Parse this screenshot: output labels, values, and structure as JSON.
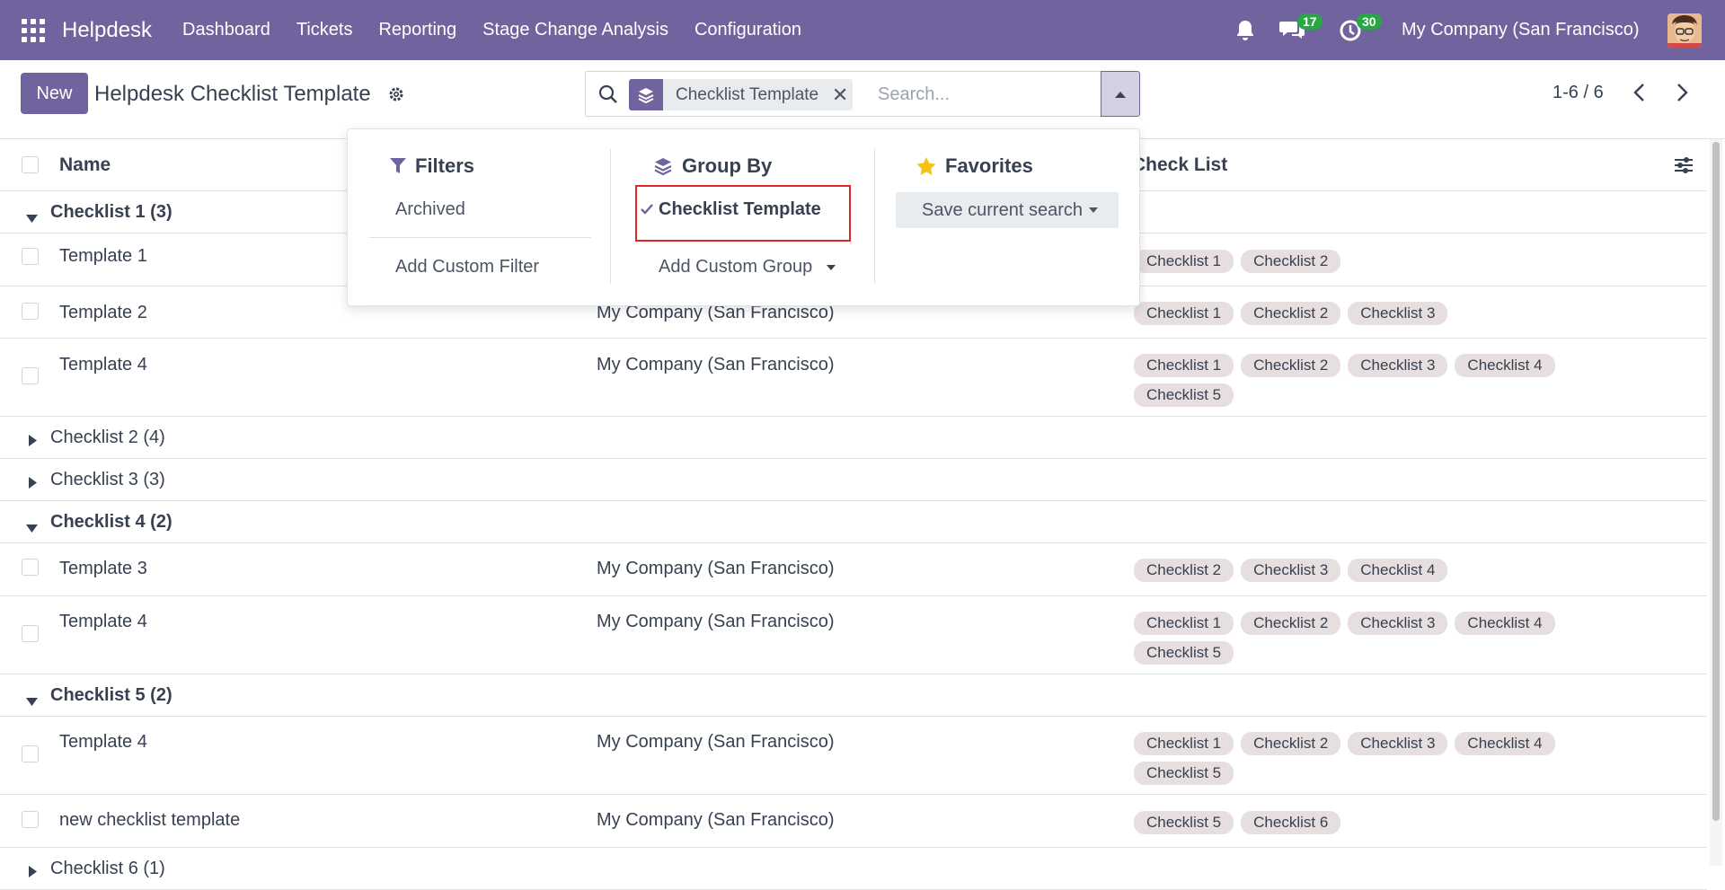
{
  "navbar": {
    "brand": "Helpdesk",
    "menu": [
      "Dashboard",
      "Tickets",
      "Reporting",
      "Stage Change Analysis",
      "Configuration"
    ],
    "chat_count": "17",
    "activity_count": "30",
    "company": "My Company (San Francisco)",
    "color": "#71639e"
  },
  "control": {
    "new_label": "New",
    "title": "Helpdesk Checklist Template",
    "facet_label": "Checklist Template",
    "search_placeholder": "Search...",
    "pager": "1-6 / 6"
  },
  "list": {
    "columns": [
      "Name",
      "Check List"
    ],
    "groups": [
      {
        "label": "Checklist 1 (3)",
        "open": true
      },
      {
        "label": "Checklist 2 (4)",
        "open": false
      },
      {
        "label": "Checklist 3 (3)",
        "open": false
      },
      {
        "label": "Checklist 4 (2)",
        "open": true
      },
      {
        "label": "Checklist 5 (2)",
        "open": true
      },
      {
        "label": "Checklist 6 (1)",
        "open": false
      }
    ],
    "rows": [
      {
        "name": "Template 1",
        "company": "",
        "tags": [
          "Checklist 1",
          "Checklist 2"
        ]
      },
      {
        "name": "Template 2",
        "company": "My Company (San Francisco)",
        "tags": [
          "Checklist 1",
          "Checklist 2",
          "Checklist 3"
        ]
      },
      {
        "name": "Template 4",
        "company": "My Company (San Francisco)",
        "tags": [
          "Checklist 1",
          "Checklist 2",
          "Checklist 3",
          "Checklist 4",
          "Checklist 5"
        ]
      },
      {
        "name": "Template 3",
        "company": "My Company (San Francisco)",
        "tags": [
          "Checklist 2",
          "Checklist 3",
          "Checklist 4"
        ]
      },
      {
        "name": "Template 4",
        "company": "My Company (San Francisco)",
        "tags": [
          "Checklist 1",
          "Checklist 2",
          "Checklist 3",
          "Checklist 4",
          "Checklist 5"
        ]
      },
      {
        "name": "Template 4",
        "company": "My Company (San Francisco)",
        "tags": [
          "Checklist 1",
          "Checklist 2",
          "Checklist 3",
          "Checklist 4",
          "Checklist 5"
        ]
      },
      {
        "name": "new checklist template",
        "company": "My Company (San Francisco)",
        "tags": [
          "Checklist 5",
          "Checklist 6"
        ]
      }
    ]
  },
  "dropdown": {
    "filters": {
      "title": "Filters",
      "items": [
        "Archived",
        "Add Custom Filter"
      ]
    },
    "group_by": {
      "title": "Group By",
      "selected": "Checklist Template",
      "add_custom": "Add Custom Group"
    },
    "favorites": {
      "title": "Favorites",
      "save": "Save current search"
    }
  },
  "colors": {
    "highlight": "#e0262a",
    "tag_bg": "#e7dfdf",
    "badge": "#28a745"
  }
}
